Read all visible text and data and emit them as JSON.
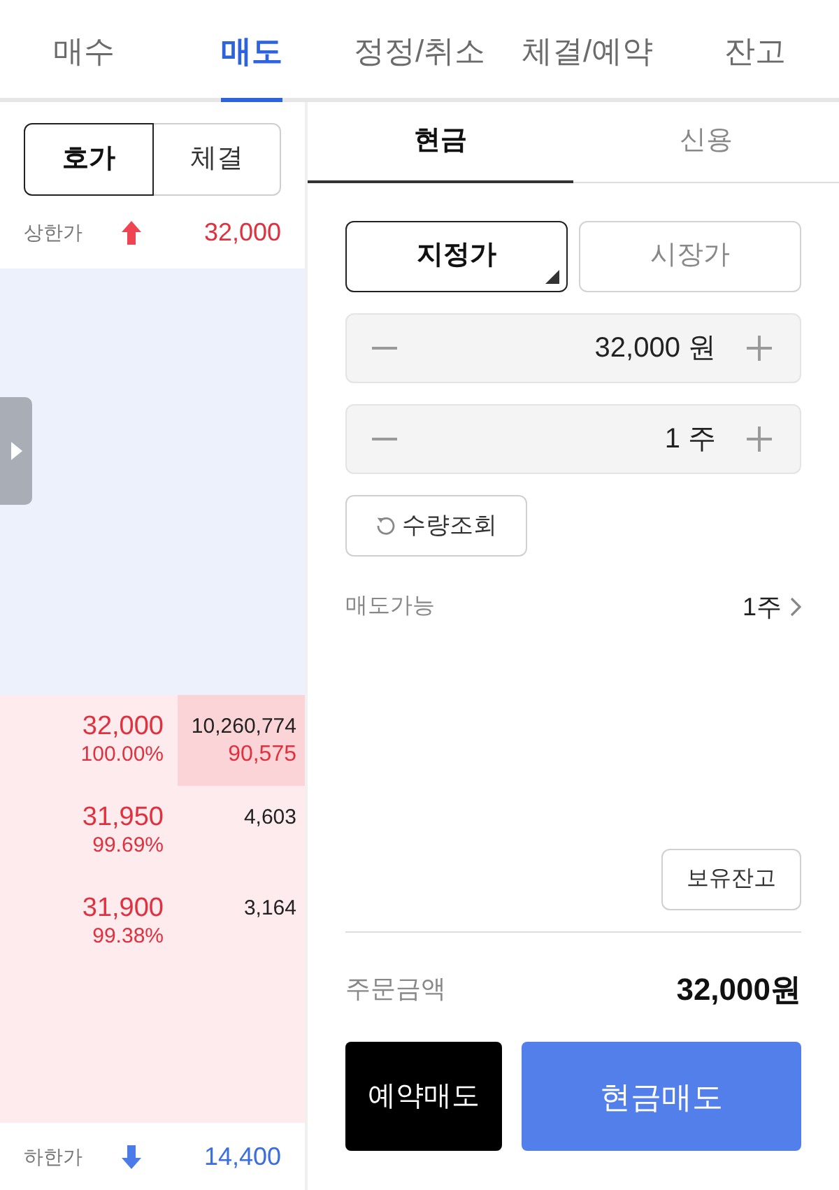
{
  "top_tabs": [
    {
      "label": "매수",
      "selected": false
    },
    {
      "label": "매도",
      "selected": true
    },
    {
      "label": "정정/취소",
      "selected": false
    },
    {
      "label": "체결/예약",
      "selected": false
    },
    {
      "label": "잔고",
      "selected": false
    }
  ],
  "orderbook": {
    "view_tabs": [
      {
        "label": "호가",
        "selected": true
      },
      {
        "label": "체결",
        "selected": false
      }
    ],
    "upper_limit": {
      "label": "상한가",
      "value": "32,000"
    },
    "ask_rows": [
      {
        "price": "32,000",
        "rate": "100.00%",
        "volume": "10,260,774",
        "change": "90,575",
        "highlighted": true
      },
      {
        "price": "31,950",
        "rate": "99.69%",
        "volume": "4,603",
        "highlighted": false
      },
      {
        "price": "31,900",
        "rate": "99.38%",
        "volume": "3,164",
        "highlighted": false
      }
    ],
    "lower_limit": {
      "label": "하한가",
      "value": "14,400"
    }
  },
  "order_form": {
    "account_tabs": [
      {
        "label": "현금",
        "selected": true
      },
      {
        "label": "신용",
        "selected": false
      }
    ],
    "order_types": [
      {
        "label": "지정가",
        "selected": true
      },
      {
        "label": "시장가",
        "selected": false
      }
    ],
    "price_field": {
      "value": "32,000 원"
    },
    "quantity_field": {
      "value": "1 주"
    },
    "quantity_check_button": {
      "label": "수량조회"
    },
    "sellable": {
      "label": "매도가능",
      "value": "1주"
    },
    "holdings_button": {
      "label": "보유잔고"
    },
    "order_amount": {
      "label": "주문금액",
      "value": "32,000원"
    },
    "actions": [
      {
        "label": "예약매도",
        "kind": "reserve"
      },
      {
        "label": "현금매도",
        "kind": "cash"
      }
    ]
  }
}
